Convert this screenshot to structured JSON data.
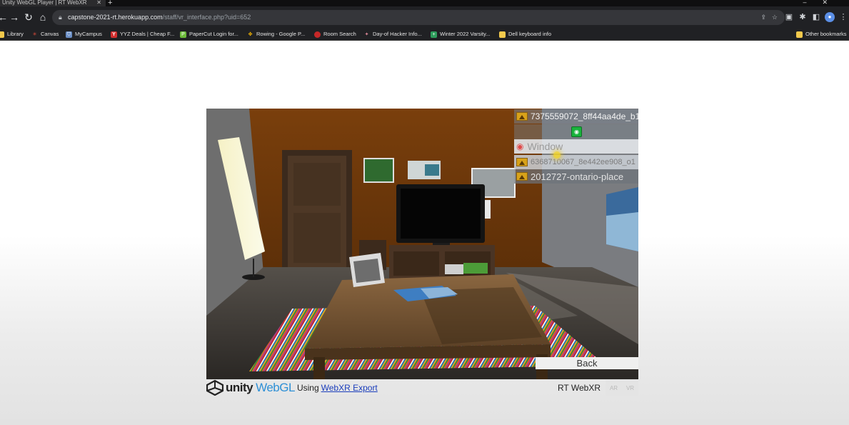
{
  "browser": {
    "tab_title": "Unity WebGL Player | RT WebXR",
    "url_host": "capstone-2021-rt.herokuapp.com",
    "url_path": "/staff/vr_interface.php?uid=652",
    "bookmarks": [
      {
        "label": "Library",
        "icon": "folder-icon",
        "color": "#f2c94c"
      },
      {
        "label": "Canvas",
        "icon": "canvas-icon",
        "color": "#d84b3b"
      },
      {
        "label": "MyCampus",
        "icon": "shield-icon",
        "color": "#6b8fc6"
      },
      {
        "label": "YYZ Deals | Cheap F...",
        "icon": "y-icon",
        "color": "#d32f2f"
      },
      {
        "label": "PaperCut Login for...",
        "icon": "papercut-icon",
        "color": "#6dbb3a"
      },
      {
        "label": "Rowing - Google P...",
        "icon": "pinwheel-icon",
        "color": "#f4b400"
      },
      {
        "label": "Room Search",
        "icon": "red-circle-icon",
        "color": "#c62828"
      },
      {
        "label": "Day-of Hacker Info...",
        "icon": "notion-icon",
        "color": "#e08a9a"
      },
      {
        "label": "Winter 2022 Varsity...",
        "icon": "plus-icon",
        "color": "#2e9d5c"
      },
      {
        "label": "Dell keyboard info",
        "icon": "folder-icon",
        "color": "#f2c94c"
      }
    ],
    "other_bookmarks": "Other bookmarks"
  },
  "vr_panel": {
    "items": [
      {
        "label": "7375559072_8ff44aa4de_b1"
      },
      {
        "label": "Window"
      },
      {
        "label": "6368710067_8e442ee908_o1"
      },
      {
        "label": "2012727-ontario-place"
      }
    ],
    "back_label": "Back"
  },
  "footer": {
    "unity": "unity",
    "webgl": "WebGL",
    "using": "Using",
    "webxr_link": "WebXR Export",
    "rt_webxr": "RT WebXR",
    "ar": "AR",
    "vr": "VR"
  },
  "colors": {
    "chrome_bg": "#202124",
    "webgl_blue": "#2e90d6",
    "link_blue": "#1a3dbb",
    "eye_green": "#19b33c"
  }
}
